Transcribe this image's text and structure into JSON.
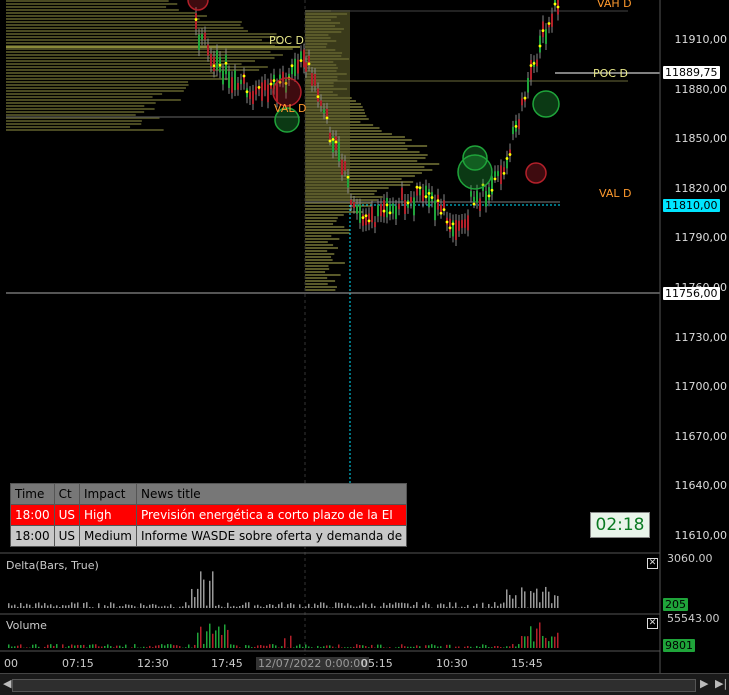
{
  "chart_data": {
    "type": "candlestick",
    "price_axis": [
      "11910,00",
      "11880,00",
      "11850,00",
      "11820,00",
      "11790,00",
      "11760,00",
      "11730,00",
      "11700,00",
      "11670,00",
      "11640,00",
      "11610,00"
    ],
    "tags": {
      "current_price": "11889,75",
      "marker_cyan": "11810,00",
      "line_white": "11756,00"
    },
    "level_labels": {
      "vah": "VAH D",
      "poc_right": "POC D",
      "val_right": "VAL D",
      "poc_left": "POC D",
      "val_left": "VAL D"
    },
    "time_axis": [
      "00",
      "07:15",
      "12:30",
      "17:45",
      "12/07/2022 0:00:00",
      "05:15",
      "10:30",
      "15:45"
    ]
  },
  "news": {
    "headers": [
      "Time",
      "Ct",
      "Impact",
      "News title"
    ],
    "rows": [
      {
        "time": "18:00",
        "ct": "US",
        "impact": "High",
        "title": "Previsión energética a corto plazo de la EI"
      },
      {
        "time": "18:00",
        "ct": "US",
        "impact": "Medium",
        "title": "Informe WASDE sobre oferta y demanda de"
      }
    ]
  },
  "timer": "02:18",
  "delta_panel": {
    "label": "Delta(Bars, True)",
    "scale": "3060.00",
    "tag": "205"
  },
  "volume_panel": {
    "label": "Volume",
    "scale": "55543.00",
    "tag": "9801"
  },
  "colors": {
    "up": "#1fa43a",
    "down": "#b3202a",
    "poc": "#e8e88a",
    "val": "#ff9a2e",
    "cyan": "#00e5ff",
    "profile": "#5a5a2a"
  }
}
